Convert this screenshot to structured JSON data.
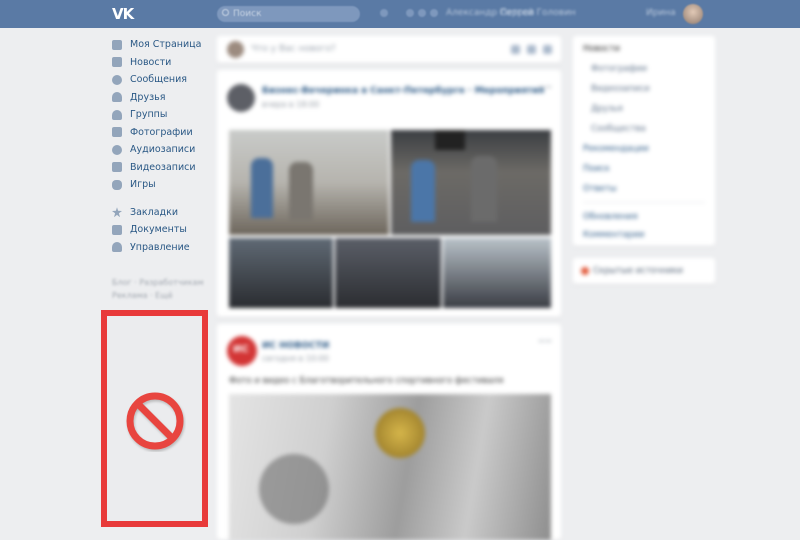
{
  "header": {
    "logo_text": "VK",
    "search_placeholder": "Поиск",
    "nav_text_1": "Александр Петров",
    "nav_text_2": "Сергей Головин",
    "username": "Ирина"
  },
  "sidebar": {
    "items": [
      {
        "label": "Моя Страница",
        "icon": "home-icon"
      },
      {
        "label": "Новости",
        "icon": "news-icon"
      },
      {
        "label": "Сообщения",
        "icon": "messages-icon"
      },
      {
        "label": "Друзья",
        "icon": "friends-icon"
      },
      {
        "label": "Группы",
        "icon": "groups-icon"
      },
      {
        "label": "Фотографии",
        "icon": "camera-icon"
      },
      {
        "label": "Аудиозаписи",
        "icon": "music-icon"
      },
      {
        "label": "Видеозаписи",
        "icon": "video-icon"
      },
      {
        "label": "Игры",
        "icon": "gamepad-icon"
      }
    ],
    "items2": [
      {
        "label": "Закладки",
        "icon": "star-icon"
      },
      {
        "label": "Документы",
        "icon": "document-icon"
      },
      {
        "label": "Управление",
        "icon": "manage-icon"
      }
    ],
    "footer_line1": "Блог · Разработчикам",
    "footer_line2": "Реклама · Ещё"
  },
  "feed": {
    "post_box_placeholder": "Что у Вас нового?",
    "post1": {
      "title": "Бизнес-Вечеринка в Санкт-Петербурге · Мероприятия",
      "date": "вчера в 18:00"
    },
    "post2": {
      "title": "ИС НОВОСТИ",
      "date": "сегодня в 10:00",
      "text": "Фото и видео с Благотворительного спортивного фестиваля",
      "avatar_text": "ИС"
    }
  },
  "right_menu": {
    "header": "Новости",
    "items": [
      "Фотографии",
      "Видеозаписи",
      "Друзья",
      "Сообщества"
    ],
    "links": [
      "Рекомендации",
      "Поиск",
      "Ответы"
    ],
    "links2": [
      "Обновления",
      "Комментарии"
    ]
  },
  "right_box2": {
    "label": "Скрытые источники"
  },
  "overlay": {
    "frame_color": "#e83a3a",
    "icon": "prohibited-icon"
  }
}
